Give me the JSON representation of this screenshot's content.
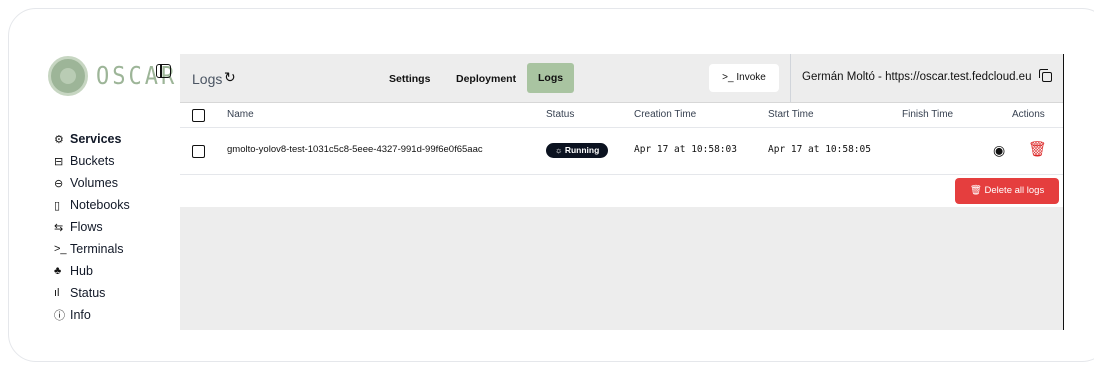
{
  "brand": {
    "name": "OSCAR",
    "color": "#9db598"
  },
  "sidebar": {
    "items": [
      {
        "label": "Services",
        "icon": "services-icon",
        "glyph": "⚙",
        "active": true
      },
      {
        "label": "Buckets",
        "icon": "bucket-icon",
        "glyph": "⊟",
        "active": false
      },
      {
        "label": "Volumes",
        "icon": "volume-icon",
        "glyph": "⊖",
        "active": false
      },
      {
        "label": "Notebooks",
        "icon": "notebook-icon",
        "glyph": "▯",
        "active": false
      },
      {
        "label": "Flows",
        "icon": "flows-icon",
        "glyph": "⇆",
        "active": false
      },
      {
        "label": "Terminals",
        "icon": "terminal-icon",
        "glyph": ">_",
        "active": false
      },
      {
        "label": "Hub",
        "icon": "hub-icon",
        "glyph": "♣",
        "active": false
      },
      {
        "label": "Status",
        "icon": "status-icon",
        "glyph": "ıl",
        "active": false
      },
      {
        "label": "Info",
        "icon": "info-icon",
        "glyph": "ⓘ",
        "active": false
      }
    ]
  },
  "header": {
    "title": "Logs",
    "tabs": {
      "settings": "Settings",
      "deployment": "Deployment",
      "logs": "Logs"
    },
    "invoke_label": ">_  Invoke",
    "user": "Germán Moltó - https://oscar.test.fedcloud.eu"
  },
  "table": {
    "columns": {
      "name": "Name",
      "status": "Status",
      "creation": "Creation Time",
      "start": "Start Time",
      "finish": "Finish Time",
      "actions": "Actions"
    },
    "rows": [
      {
        "name": "gmolto-yolov8-test-1031c5c8-5eee-4327-991d-99f6e0f65aac",
        "status": "Running",
        "creation": "Apr 17 at 10:58:03",
        "start": "Apr 17 at 10:58:05",
        "finish": ""
      }
    ],
    "delete_all_label": "Delete all logs"
  },
  "colors": {
    "accent": "#a9c4a1",
    "danger": "#e53e3e",
    "badge": "#0b1220"
  }
}
